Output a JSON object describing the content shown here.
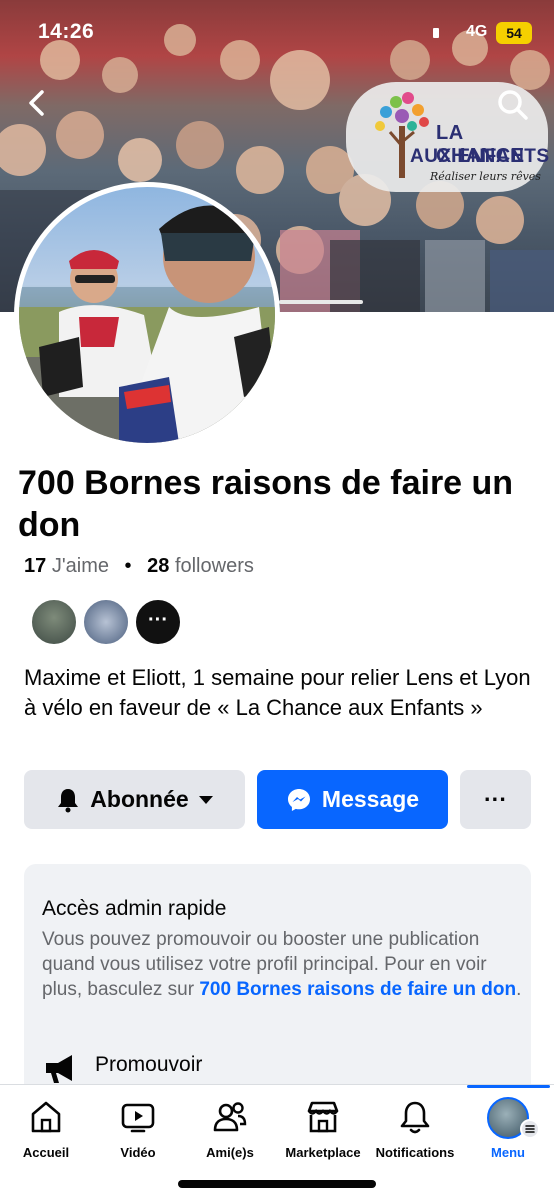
{
  "status_bar": {
    "time": "14:26",
    "network": "4G",
    "battery": "54"
  },
  "cover": {
    "logo_line1": "LA CHANCE",
    "logo_line2": "AUX ENFANTS",
    "logo_tagline": "Réaliser leurs rêves"
  },
  "page": {
    "title": "700 Bornes raisons de faire un don",
    "likes_count": "17",
    "likes_label": "J'aime",
    "followers_count": "28",
    "followers_label": "followers",
    "more_friends": "···",
    "bio": "Maxime et Eliott, 1 semaine pour relier Lens et Lyon à vélo en faveur de « La Chance aux Enfants »"
  },
  "actions": {
    "follow_label": "Abonnée",
    "message_label": "Message",
    "more_label": "···"
  },
  "admin_card": {
    "title": "Accès admin rapide",
    "description": "Vous pouvez promouvoir ou booster une publication quand vous utilisez votre profil principal. Pour en voir plus, basculez sur ",
    "link_text": "700 Bornes raisons de faire un don",
    "end": ".",
    "promote_label": "Promouvoir"
  },
  "tabs": [
    {
      "label": "Accueil",
      "icon": "home-icon"
    },
    {
      "label": "Vidéo",
      "icon": "video-icon"
    },
    {
      "label": "Ami(e)s",
      "icon": "friends-icon"
    },
    {
      "label": "Marketplace",
      "icon": "marketplace-icon"
    },
    {
      "label": "Notifications",
      "icon": "bell-icon"
    },
    {
      "label": "Menu",
      "icon": "menu-avatar",
      "active": true
    }
  ],
  "colors": {
    "accent": "#0866ff",
    "button_gray": "#e4e6eb",
    "card_bg": "#f0f2f5",
    "secondary_text": "#65676b"
  }
}
